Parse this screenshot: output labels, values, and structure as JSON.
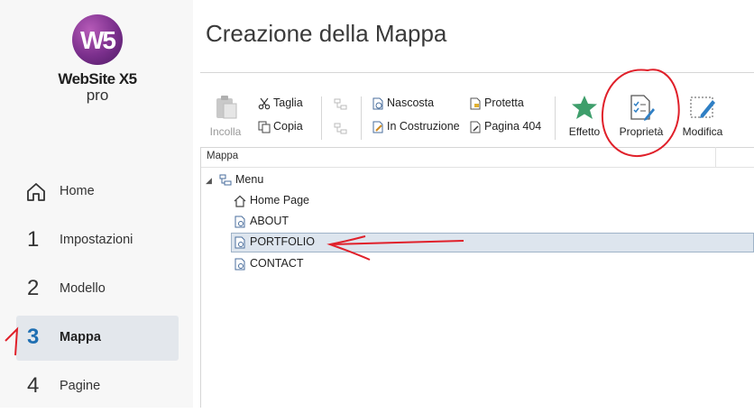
{
  "app": {
    "logo_letters": "W5",
    "logo_name": "WebSite X5",
    "logo_sub": "pro"
  },
  "nav": {
    "items": [
      {
        "num": "",
        "label": "Home"
      },
      {
        "num": "1",
        "label": "Impostazioni"
      },
      {
        "num": "2",
        "label": "Modello"
      },
      {
        "num": "3",
        "label": "Mappa"
      },
      {
        "num": "4",
        "label": "Pagine"
      }
    ]
  },
  "page": {
    "title": "Creazione della Mappa"
  },
  "toolbar": {
    "paste": "Incolla",
    "cut": "Taglia",
    "copy": "Copia",
    "hidden": "Nascosta",
    "under_construction": "In Costruzione",
    "protected": "Protetta",
    "page404": "Pagina 404",
    "effect": "Effetto",
    "properties": "Proprietà",
    "edit": "Modifica"
  },
  "tree": {
    "header": "Mappa",
    "root": "Menu",
    "nodes": [
      "Home Page",
      "ABOUT",
      "PORTFOLIO",
      "CONTACT"
    ],
    "selected": "PORTFOLIO"
  },
  "annotation": {
    "mark": "1"
  },
  "colors": {
    "accent": "#1f6fb2",
    "star": "#3e9e6b",
    "annotation": "#e0202a",
    "logo": "#7a2f8c"
  }
}
